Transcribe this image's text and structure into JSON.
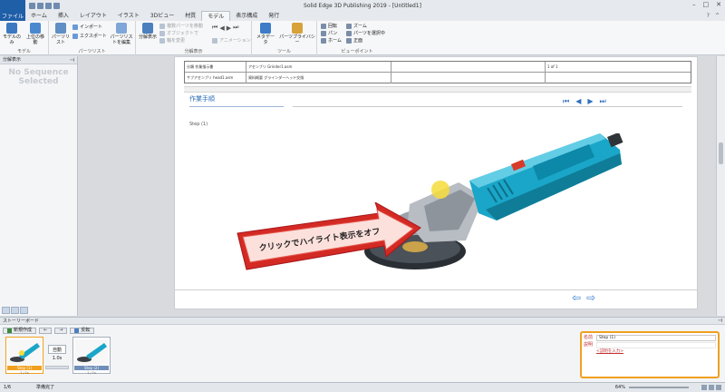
{
  "app": {
    "title": "Solid Edge 3D Publishing 2019 - [Untitled1]",
    "file_tab": "ファイル",
    "tabs": [
      "ホーム",
      "挿入",
      "レイアウト",
      "イラスト",
      "3Dビュー",
      "材質",
      "モデル",
      "表示構成",
      "発行"
    ],
    "active_tab": "モデル",
    "colors": {
      "accent": "#1f5fa8",
      "highlight": "#f0a020",
      "arrow": "#d42a24"
    }
  },
  "ribbon": {
    "groups": {
      "model": {
        "label": "モデル",
        "items": [
          "モデルのみ",
          "上位の移動"
        ]
      },
      "partslist": {
        "label": "パーツリスト",
        "items": [
          "パーツリスト",
          "インポート",
          "エクスポート",
          "パーツリストを編集"
        ]
      },
      "exploded": {
        "label": "分解表示",
        "big": "分解表示",
        "items": [
          "複数パーツを移動",
          "オブジェクトで",
          "軸を変更",
          "アニメーション"
        ]
      },
      "tools": {
        "label": "ツール",
        "items": [
          "メタデータ",
          "パーツプライバシー"
        ]
      },
      "viewpoint": {
        "label": "ビューポイント",
        "items": [
          "回転",
          "パン",
          "ホーム",
          "ズーム",
          "パーツを選択中",
          "正面"
        ]
      }
    }
  },
  "left_panel": {
    "title": "分解表示",
    "empty_state": "No Sequence Selected"
  },
  "document": {
    "header": {
      "rows": [
        [
          "分類 作業指示書",
          "アセンブリ Grinder1.asm",
          "",
          "1 of 1"
        ],
        [
          "サブアセンブリ head1.asm",
          "資料概要 グラインダーヘッド交換",
          "",
          ""
        ]
      ]
    },
    "work_title": "作業手順",
    "step": "Step (1)",
    "callout_text": "クリックでハイライト表示をオフ",
    "nav_icons": [
      "first-icon",
      "prev-icon",
      "next-icon",
      "last-icon"
    ]
  },
  "storyboard": {
    "title": "ストーリーボード",
    "new_button": "新規作成",
    "reverse_button": "反転",
    "frames": [
      {
        "label": "Step (1)",
        "sub": "1 / 1s",
        "selected": true
      },
      {
        "label": "Step (2)",
        "sub": "1 / 1s",
        "selected": false
      }
    ],
    "auto": "自動",
    "duration": "1.0s"
  },
  "properties": {
    "name_label": "名前",
    "name_value": "Step (1)",
    "desc_label": "説明",
    "desc_value": "<説明を入力>"
  },
  "status": {
    "count": "1/6",
    "text": "準備完了",
    "zoom": "64%"
  }
}
